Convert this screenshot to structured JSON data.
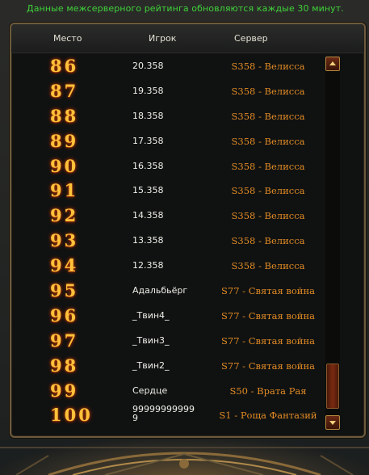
{
  "notice": "Данные межсерверного рейтинга обновляются каждые 30 минут.",
  "headers": {
    "place": "Место",
    "player": "Игрок",
    "server": "Сервер"
  },
  "rows": [
    {
      "rank": "86",
      "player": "20.358",
      "server": "S358 - Велисса"
    },
    {
      "rank": "87",
      "player": "19.358",
      "server": "S358 - Велисса"
    },
    {
      "rank": "88",
      "player": "18.358",
      "server": "S358 - Велисса"
    },
    {
      "rank": "89",
      "player": "17.358",
      "server": "S358 - Велисса"
    },
    {
      "rank": "90",
      "player": "16.358",
      "server": "S358 - Велисса"
    },
    {
      "rank": "91",
      "player": "15.358",
      "server": "S358 - Велисса"
    },
    {
      "rank": "92",
      "player": "14.358",
      "server": "S358 - Велисса"
    },
    {
      "rank": "93",
      "player": "13.358",
      "server": "S358 - Велисса"
    },
    {
      "rank": "94",
      "player": "12.358",
      "server": "S358 - Велисса"
    },
    {
      "rank": "95",
      "player": "Адальбьёрг",
      "server": "S77 - Святая война"
    },
    {
      "rank": "96",
      "player": "_Твин4_",
      "server": "S77 - Святая война"
    },
    {
      "rank": "97",
      "player": "_Твин3_",
      "server": "S77 - Святая война"
    },
    {
      "rank": "98",
      "player": "_Твин2_",
      "server": "S77 - Святая война"
    },
    {
      "rank": "99",
      "player": "Сердце",
      "server": "S50 - Врата Рая"
    },
    {
      "rank": "100",
      "player": "99999999999\n9",
      "server": "S1 - Роща Фантазий"
    }
  ],
  "colors": {
    "notice": "#3fd23a",
    "rank": "#ffc23a",
    "server": "#e08a24",
    "player": "#efefe8"
  },
  "icons": {
    "scroll_up": "triangle-up-icon",
    "scroll_down": "triangle-down-icon"
  }
}
